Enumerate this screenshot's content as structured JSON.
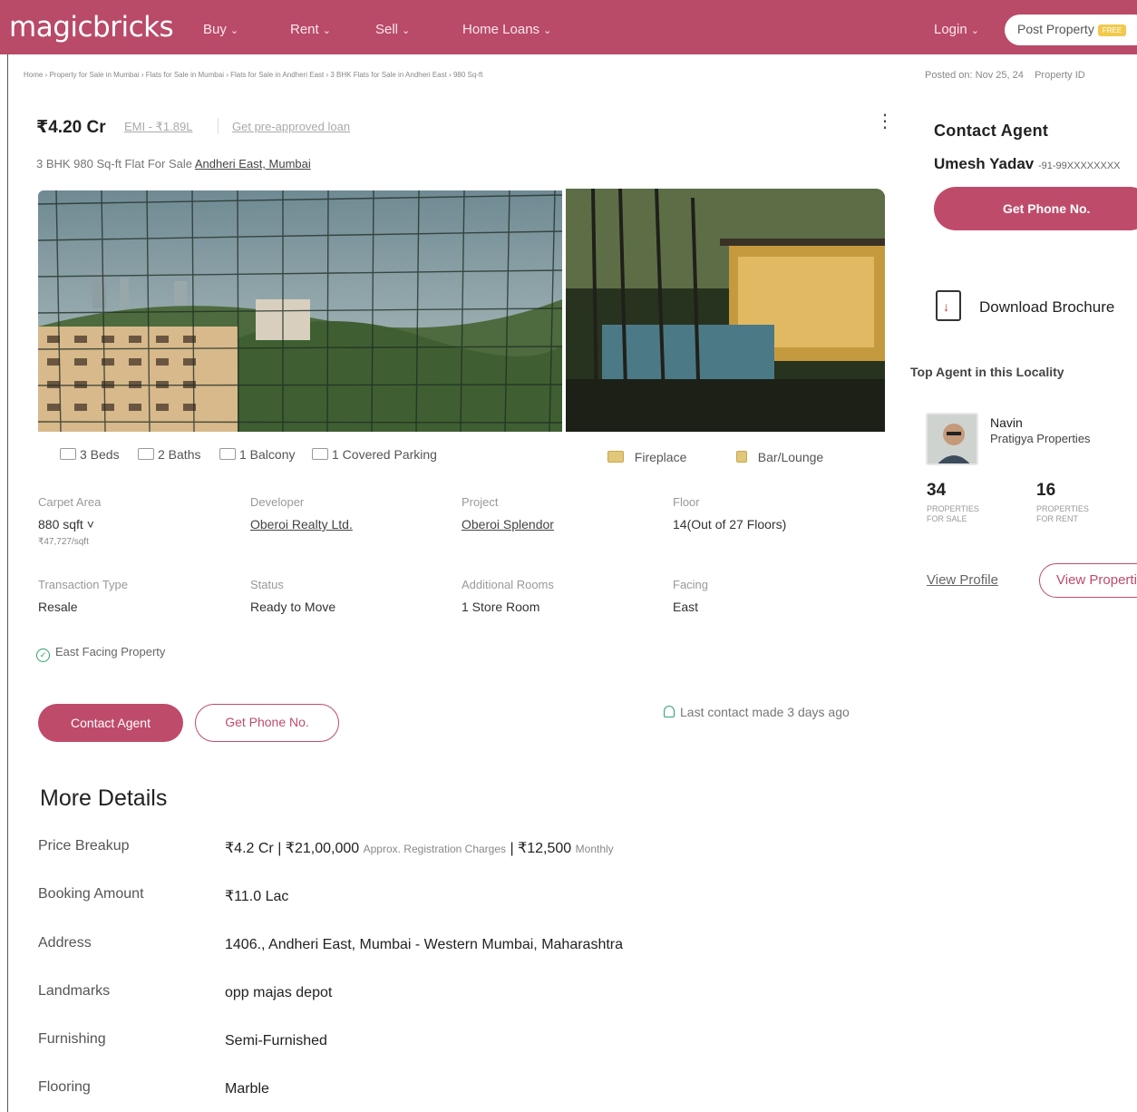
{
  "header": {
    "logo": "magicbricks",
    "nav": [
      {
        "label": "Buy"
      },
      {
        "label": "Rent"
      },
      {
        "label": "Sell"
      },
      {
        "label": "Home Loans"
      }
    ],
    "login": "Login",
    "post_property": "Post Property",
    "post_property_badge": "FREE",
    "brand_color": "#b94a68"
  },
  "breadcrumb": "Home › Property for Sale in Mumbai › Flats for Sale in Mumbai › Flats for Sale in Andheri East › 3 BHK Flats for Sale in Andheri East › 980 Sq-ft",
  "posted_on": "Posted on: Nov 25, 24",
  "property_id_label": "Property ID",
  "listing": {
    "price": "₹4.20 Cr",
    "emi": "EMI - ₹1.89L",
    "pre_approved": "Get pre-approved loan",
    "subtitle": "3 BHK 980 Sq-ft Flat For Sale",
    "locality": "Andheri East, Mumbai"
  },
  "amenities": {
    "beds": "3 Beds",
    "baths": "2 Baths",
    "balcony": "1 Balcony",
    "parking": "1 Covered Parking",
    "fireplace": "Fireplace",
    "bar": "Bar/Lounge"
  },
  "summary": {
    "carpet_area_label": "Carpet Area",
    "carpet_area_value": "880 sqft",
    "carpet_area_rate": "₹47,727/sqft",
    "developer_label": "Developer",
    "developer_value": "Oberoi Realty Ltd.",
    "project_label": "Project",
    "project_value": "Oberoi Splendor",
    "floor_label": "Floor",
    "floor_value": "14(Out of 27 Floors)",
    "transaction_label": "Transaction Type",
    "transaction_value": "Resale",
    "status_label": "Status",
    "status_value": "Ready to Move",
    "rooms_label": "Additional Rooms",
    "rooms_value": "1 Store Room",
    "facing_label": "Facing",
    "facing_value": "East"
  },
  "highlight": "East Facing Property",
  "actions": {
    "contact_agent": "Contact Agent",
    "get_phone": "Get Phone No.",
    "last_contact": "Last contact made 3 days ago"
  },
  "more_details": {
    "title": "More Details",
    "rows": [
      {
        "label": "Price Breakup",
        "value": "₹4.2 Cr | ₹21,00,000",
        "muted": "Approx. Registration Charges",
        "value2": " | ₹12,500",
        "muted2": "Monthly"
      },
      {
        "label": "Booking Amount",
        "value": "₹11.0 Lac"
      },
      {
        "label": "Address",
        "value": "1406., Andheri East, Mumbai - Western Mumbai, Maharashtra"
      },
      {
        "label": "Landmarks",
        "value": "opp majas depot"
      },
      {
        "label": "Furnishing",
        "value": "Semi-Furnished"
      },
      {
        "label": "Flooring",
        "value": "Marble"
      }
    ]
  },
  "sidebar": {
    "contact_title": "Contact Agent",
    "agent_name": "Umesh Yadav",
    "agent_phone": "-91-99XXXXXXXX",
    "get_phone": "Get Phone No.",
    "brochure": "Download Brochure",
    "top_agent_title": "Top Agent in this Locality",
    "top_agent_name": "Navin",
    "top_agent_company": "Pratigya Properties",
    "sale_count": "34",
    "sale_label_1": "PROPERTIES",
    "sale_label_2": "FOR SALE",
    "rent_count": "16",
    "rent_label_1": "PROPERTIES",
    "rent_label_2": "FOR RENT",
    "view_profile": "View Profile",
    "view_properties": "View Properties"
  }
}
